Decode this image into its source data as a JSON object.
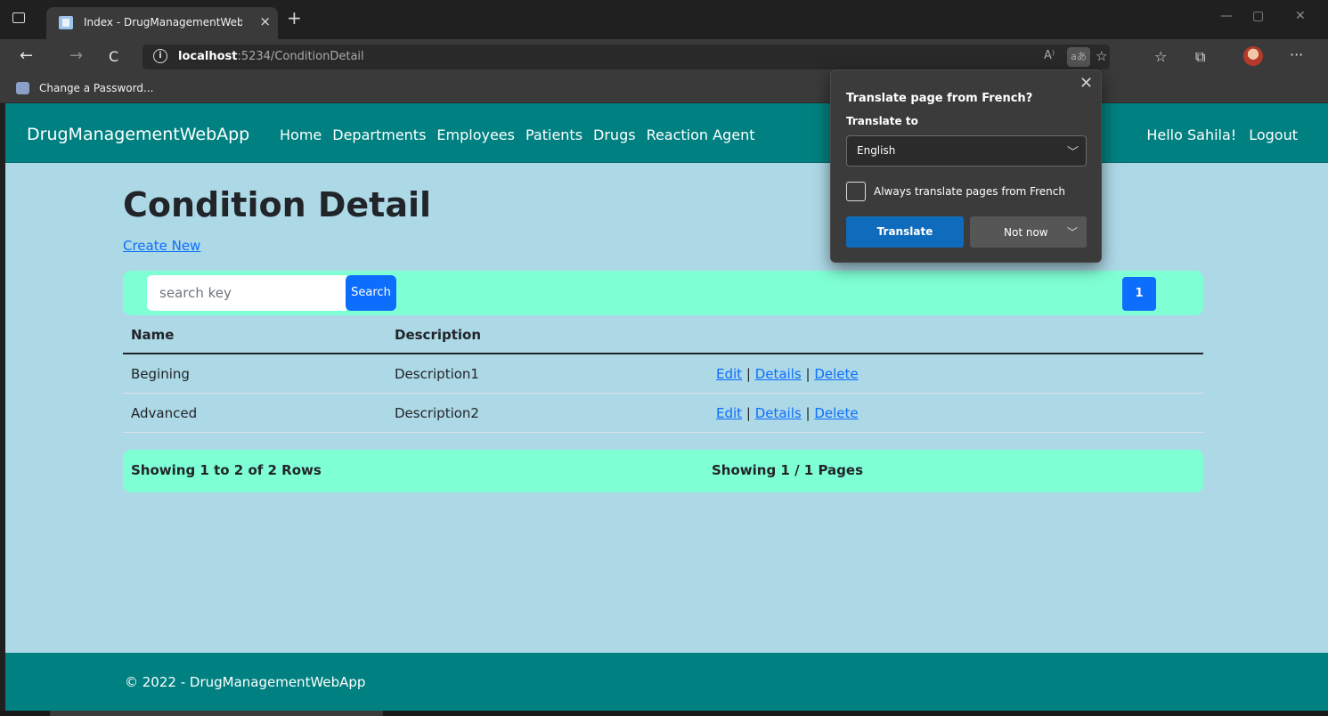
{
  "browser": {
    "tab_title": "Index - DrugManagementWebApp",
    "tab_close": "×",
    "new_tab": "+",
    "window_controls": {
      "minimize": "—",
      "restore": "▢",
      "close": "✕"
    },
    "nav": {
      "back": "←",
      "forward": "→",
      "reload": "C"
    },
    "url_host": "localhost",
    "url_path": ":5234/ConditionDetail",
    "read_aloud": "A⁾",
    "translate_icon": "aあ",
    "bookmark": "Change a Password..."
  },
  "translate_popup": {
    "title": "Translate page from French?",
    "close": "✕",
    "translate_to_label": "Translate to",
    "language": "English",
    "always_label": "Always translate pages from French",
    "translate_button": "Translate",
    "not_now_button": "Not now"
  },
  "app": {
    "brand": "DrugManagementWebApp",
    "nav_links": [
      "Home",
      "Departments",
      "Employees",
      "Patients",
      "Drugs",
      "Reaction Agent"
    ],
    "greeting": "Hello Sahila!",
    "logout": "Logout"
  },
  "main": {
    "title": "Condition Detail",
    "create_new": "Create New",
    "search_placeholder": "search key",
    "search_button": "Search",
    "page_button": "1",
    "columns": [
      "Name",
      "Description",
      ""
    ],
    "rows": [
      {
        "name": "Begining",
        "description": "Description1"
      },
      {
        "name": "Advanced",
        "description": "Description2"
      }
    ],
    "actions": {
      "edit": "Edit",
      "details": "Details",
      "delete": "Delete",
      "separator": "|"
    },
    "rows_summary": "Showing 1 to 2 of 2 Rows",
    "pages_summary": "Showing 1 / 1 Pages"
  },
  "footer": {
    "copyright": "© 2022 - DrugManagementWebApp"
  }
}
